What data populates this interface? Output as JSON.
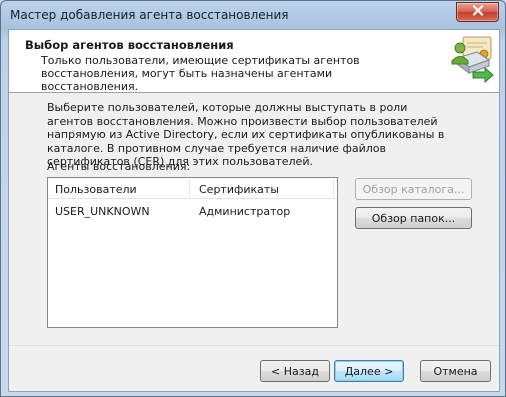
{
  "window": {
    "title": "Мастер добавления агента восстановления"
  },
  "header": {
    "title": "Выбор агентов восстановления",
    "description": "Только пользователи, имеющие сертификаты агентов восстановления, могут быть назначены агентами восстановления.",
    "icon": "certificate-agent-icon"
  },
  "main": {
    "description": "Выберите пользователей, которые должны выступать в роли агентов восстановления. Можно произвести выбор пользователей напрямую из Active Directory, если их сертификаты опубликованы в каталоге. В противном случае требуется наличие файлов сертификатов (CER) для этих пользователей.",
    "agents_label": "Агенты восстановления:",
    "columns": [
      "Пользователи",
      "Сертификаты"
    ],
    "rows": [
      {
        "user": "USER_UNKNOWN",
        "certificate": "Администратор"
      }
    ],
    "browse_directory_label": "Обзор каталога...",
    "browse_folders_label": "Обзор папок..."
  },
  "footer": {
    "back_label": "< Назад",
    "next_label": "Далее >",
    "cancel_label": "Отмена"
  },
  "colors": {
    "close_button": "#c4402c",
    "default_button_border": "#3c7fb1"
  }
}
